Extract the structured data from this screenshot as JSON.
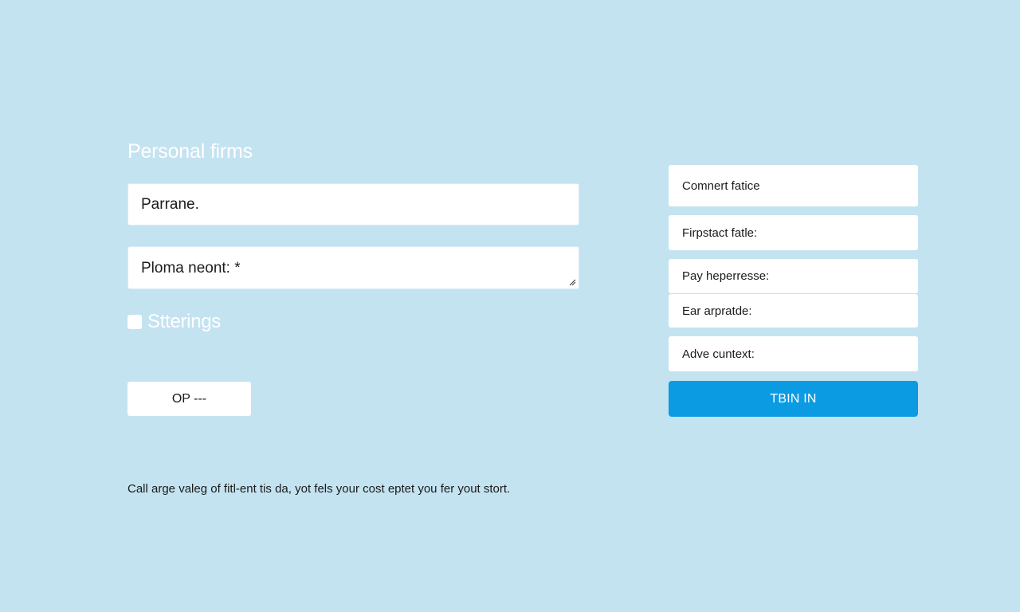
{
  "left_form": {
    "title": "Personal firms",
    "name_value": "Parrane.",
    "note_value": "Ploma neont: *",
    "checkbox_label": "Stterings",
    "op_button_label": "OP ---",
    "footer_note": "Call arge valeg of fitl-ent tis da, yot fels your cost eptet you fer yout stort."
  },
  "right_form": {
    "fields": [
      {
        "label": "Comnert fatice"
      },
      {
        "label": "Firpstact fatle:"
      },
      {
        "label": "Pay heperresse:"
      },
      {
        "label": "Ear arpratde:"
      },
      {
        "label": "Adve cuntext:"
      }
    ],
    "submit_label": "TBIN IN"
  },
  "colors": {
    "background": "#c4e3f1",
    "accent": "#0a9be3",
    "panel": "#ffffff"
  }
}
